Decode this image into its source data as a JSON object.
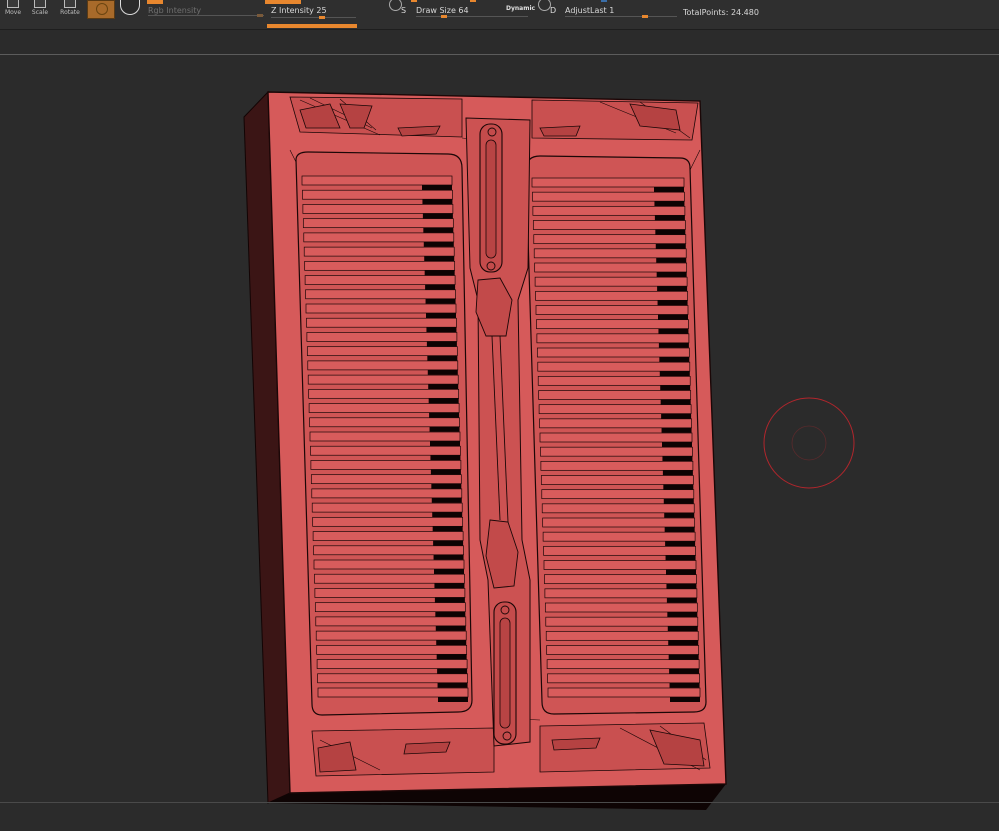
{
  "toolbar": {
    "tools": [
      {
        "label": "Move",
        "icon": "move-icon"
      },
      {
        "label": "Scale",
        "icon": "scale-icon"
      },
      {
        "label": "Rotate",
        "icon": "rotate-icon"
      }
    ],
    "material_icon": "material-swatch-icon",
    "alpha_icon": "alpha-swatch-icon",
    "rgb_intensity_label": "Rgb Intensity",
    "z_intensity_label": "Z Intensity 25",
    "z_intensity_value": 25,
    "draw_size_label": "Draw Size 64",
    "draw_size_value": 64,
    "dynamic_label": "Dynamic",
    "adjust_last_label": "AdjustLast 1",
    "adjust_last_value": 1,
    "s_letter": "S",
    "d_letter": "D",
    "total_points_label": "TotalPoints: 24.480"
  },
  "canvas": {
    "mesh_color": "#d65a5a",
    "wire_color": "#1b0707",
    "side_color": "#3a1414",
    "background_color": "#2b2b2b",
    "brush_cursor_color": "#b0262c",
    "slat_rows": 37
  },
  "accent_color": "#e8872e"
}
